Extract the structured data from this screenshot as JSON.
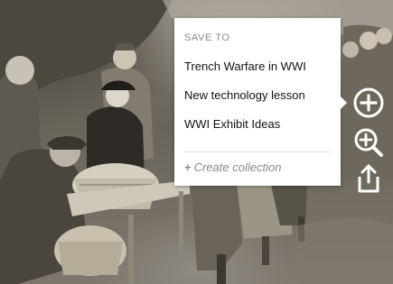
{
  "save_popup": {
    "title": "SAVE TO",
    "collections": [
      "Trench Warfare in WWI",
      "New technology lesson",
      "WWI Exhibit Ideas"
    ],
    "create_label": "Create collection"
  },
  "icons": {
    "add": "plus-circle-icon",
    "zoom": "zoom-in-icon",
    "share": "share-icon"
  }
}
